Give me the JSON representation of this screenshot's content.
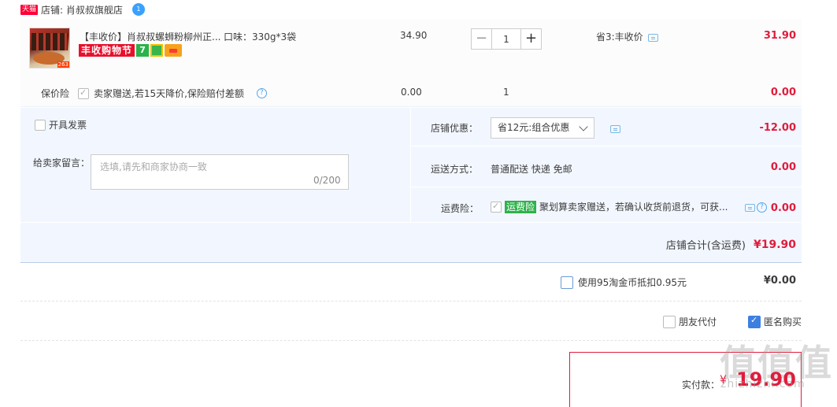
{
  "store": {
    "badge": "天猫",
    "label": "店铺: 肖叔叔旗舰店",
    "chat": "1"
  },
  "item": {
    "title": "【丰收价】肖叔叔螺蛳粉柳州正...",
    "spec": "口味：330g*3袋",
    "badge_fest": "丰收购物节",
    "badge_7": "7",
    "thumb_tag": "263",
    "price": "34.90",
    "qty": "1",
    "qty_minus": "−",
    "qty_plus": "+",
    "saving": "省3:丰收价",
    "total": "31.90"
  },
  "insurance": {
    "label": "保价险",
    "desc": "卖家赠送,若15天降价,保险赔付差额",
    "help": "?",
    "price": "0.00",
    "qty": "1",
    "total": "0.00"
  },
  "invoice": {
    "label": "开具发票"
  },
  "message": {
    "label": "给卖家留言：",
    "placeholder": "选填,请先和商家协商一致",
    "count": "0/200"
  },
  "discount": {
    "label": "店铺优惠：",
    "selected": "省12元:组合优惠",
    "amount": "-12.00"
  },
  "shipping": {
    "label": "运送方式：",
    "value": "普通配送 快递 免邮",
    "amount": "0.00"
  },
  "freight_ins": {
    "label": "运费险：",
    "tag": "运费险",
    "desc": "聚划算卖家赠送，若确认收货前退货，可获...",
    "help": "?",
    "amount": "0.00"
  },
  "store_total": {
    "label": "店铺合计(含运费)",
    "amount": "¥19.90"
  },
  "coins": {
    "label": "使用95淘金币抵扣0.95元",
    "amount": "¥0.00"
  },
  "options": {
    "friend_pay": "朋友代付",
    "anonymous": "匿名购买"
  },
  "payment": {
    "label": "实付款：",
    "yen": "¥",
    "amount": "19.90"
  },
  "watermark": {
    "big": "值值值",
    "small": "zhizhizhi.com"
  }
}
